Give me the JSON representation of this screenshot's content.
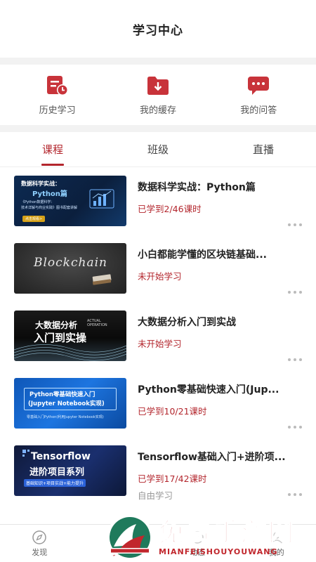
{
  "header": {
    "title": "学习中心"
  },
  "quick_actions": [
    {
      "label": "历史学习",
      "icon": "history-icon"
    },
    {
      "label": "我的缓存",
      "icon": "download-folder-icon"
    },
    {
      "label": "我的问答",
      "icon": "chat-bubble-icon"
    }
  ],
  "tabs": [
    {
      "label": "课程",
      "active": true
    },
    {
      "label": "班级",
      "active": false
    },
    {
      "label": "直播",
      "active": false
    }
  ],
  "courses": [
    {
      "title": "数据科学实战：Python篇",
      "progress": "已学到2/46课时",
      "extra": "",
      "thumb": {
        "line1": "数据科学实战：",
        "line2": "Python篇",
        "line3": "《Python数据科学：",
        "line4": "技术详解与商业实践》图书配套讲解",
        "button": "点击观看>"
      }
    },
    {
      "title": "小白都能学懂的区块链基础...",
      "progress": "未开始学习",
      "extra": "",
      "thumb": {
        "line1": "Blockchain"
      }
    },
    {
      "title": "大数据分析入门到实战",
      "progress": "未开始学习",
      "extra": "",
      "thumb": {
        "line1": "大数据分析",
        "line2": "入门到实操",
        "line3": "ACTUAL",
        "line4": "OPERATION"
      }
    },
    {
      "title": "Python零基础快速入门(Jup...",
      "progress": "已学到10/21课时",
      "extra": "",
      "thumb": {
        "line1": "Python零基础快速入门",
        "line2": "(Jupyter Notebook实现)",
        "line3": "零基础入门Python(利用Jupyter Notebook实现)"
      }
    },
    {
      "title": "Tensorflow基础入门+进阶项...",
      "progress": "已学到17/42课时",
      "extra": "自由学习",
      "thumb": {
        "line1": "Tensorflow",
        "line2": "进阶项目系列",
        "line3": "基础知识+项目实战+能力提升"
      }
    }
  ],
  "bottom_nav": [
    {
      "label": "发现",
      "icon": "compass-icon"
    },
    {
      "label": "学习",
      "icon": "book-icon"
    },
    {
      "label": "动态",
      "icon": "activity-icon"
    },
    {
      "label": "我的",
      "icon": "user-icon"
    }
  ],
  "watermark": {
    "main": "免费手游网",
    "sub": "MIANFEISHOUYOUWANG"
  },
  "colors": {
    "accent": "#b3262d",
    "background": "#f2f2f2"
  }
}
